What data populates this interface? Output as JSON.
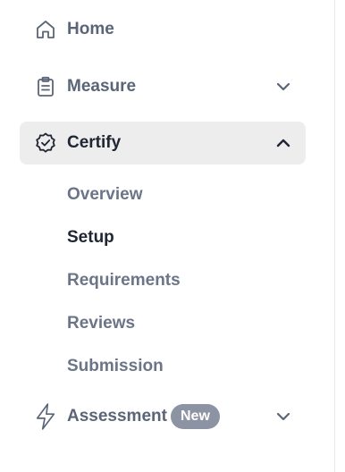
{
  "nav": {
    "home": {
      "label": "Home",
      "icon": "home-icon"
    },
    "measure": {
      "label": "Measure",
      "icon": "clipboard-icon",
      "chevron": "chevron-down-icon"
    },
    "certify": {
      "label": "Certify",
      "icon": "badge-check-icon",
      "chevron": "chevron-up-icon",
      "expanded": true,
      "subitems": [
        {
          "label": "Overview",
          "current": false
        },
        {
          "label": "Setup",
          "current": true
        },
        {
          "label": "Requirements",
          "current": false
        },
        {
          "label": "Reviews",
          "current": false
        },
        {
          "label": "Submission",
          "current": false
        }
      ]
    },
    "assessment": {
      "label": "Assessment",
      "badge": "New",
      "icon": "lightning-icon",
      "chevron": "chevron-down-icon"
    }
  },
  "colors": {
    "text_muted": "#5b6577",
    "text_active": "#1f2532",
    "active_bg": "#ededed",
    "badge_bg": "#8c94a3"
  }
}
